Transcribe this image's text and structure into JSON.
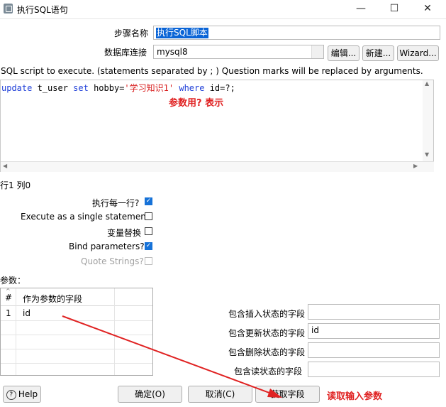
{
  "window": {
    "title": "执行SQL语句",
    "minimize": "—",
    "maximize": "☐",
    "close": "✕"
  },
  "form": {
    "step_name_label": "步骤名称",
    "step_name_value": "执行SQL脚本",
    "connection_label": "数据库连接",
    "connection_value": "mysql8",
    "edit_button": "编辑...",
    "new_button": "新建...",
    "wizard_button": "Wizard..."
  },
  "sql": {
    "description": "SQL script to execute. (statements separated by ; ) Question marks will be replaced by arguments.",
    "code_kw1": "update",
    "code_part1": " t_user ",
    "code_kw2": "set",
    "code_part2": " hobby=",
    "code_string": "'学习知识1'",
    "code_part3": " ",
    "code_kw3": "where",
    "code_part4": " id=?;",
    "annotation": "参数用? 表示",
    "cursor_pos": "行1 列0"
  },
  "options": {
    "exec_each_row": "执行每一行?",
    "single_statement": "Execute as a single statement",
    "variable_sub": "变量替换",
    "bind_params": "Bind parameters?",
    "quote_strings": "Quote Strings?",
    "exec_each_row_checked": true,
    "single_statement_checked": false,
    "variable_sub_checked": false,
    "bind_params_checked": true,
    "quote_strings_checked": false
  },
  "params": {
    "label": "参数：",
    "col_hash": "#",
    "col_field": "作为参数的字段",
    "rows": [
      {
        "num": "1",
        "field": "id"
      }
    ]
  },
  "status_fields": {
    "insert_label": "包含插入状态的字段",
    "insert_value": "",
    "update_label": "包含更新状态的字段",
    "update_value": "id",
    "delete_label": "包含删除状态的字段",
    "delete_value": "",
    "read_label": "包含读状态的字段",
    "read_value": ""
  },
  "footer": {
    "help": "Help",
    "ok": "确定(O)",
    "cancel": "取消(C)",
    "get_fields": "获取字段",
    "annotation": "读取输入参数"
  },
  "colors": {
    "annotation_red": "#e02222",
    "keyword_blue": "#1f3fd8",
    "check_blue": "#1672d8"
  }
}
